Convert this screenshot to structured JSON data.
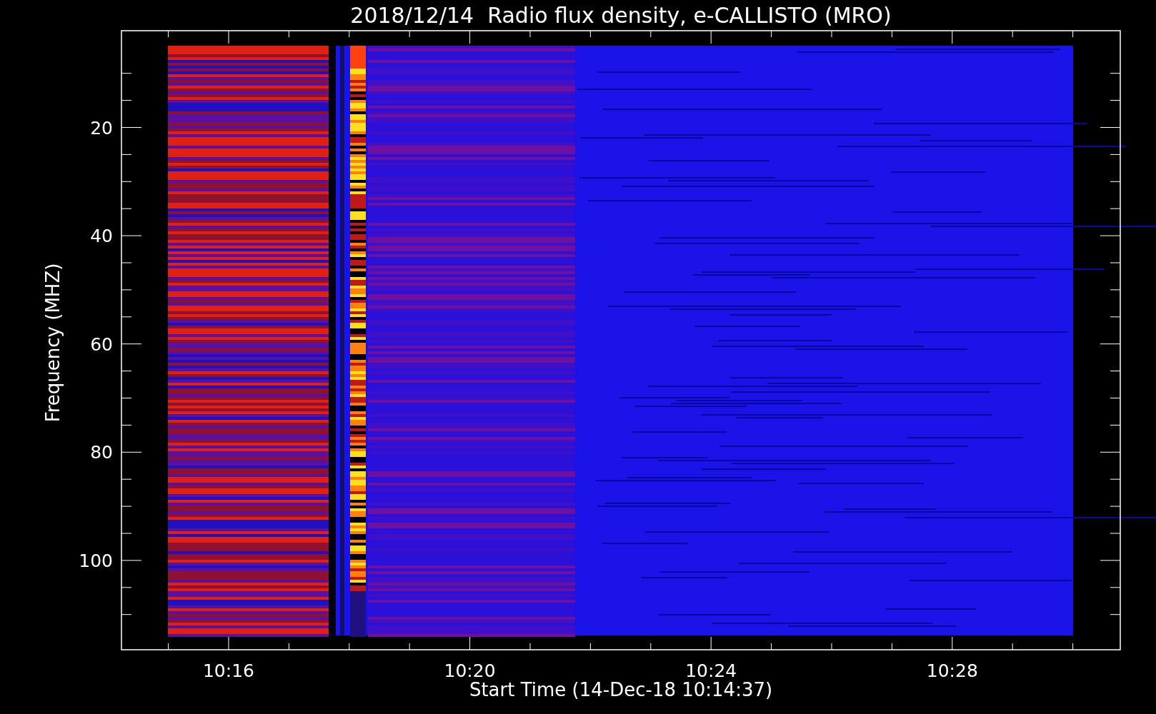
{
  "title": "2018/12/14  Radio flux density, e-CALLISTO (MRO)",
  "y_axis": {
    "label": "Frequency (MHZ)",
    "ticks": [
      "20",
      "40",
      "60",
      "80",
      "100"
    ]
  },
  "x_axis": {
    "label": "Start Time (14-Dec-18 10:14:37)",
    "ticks": [
      "10:16",
      "10:20",
      "10:24",
      "10:28"
    ]
  }
}
